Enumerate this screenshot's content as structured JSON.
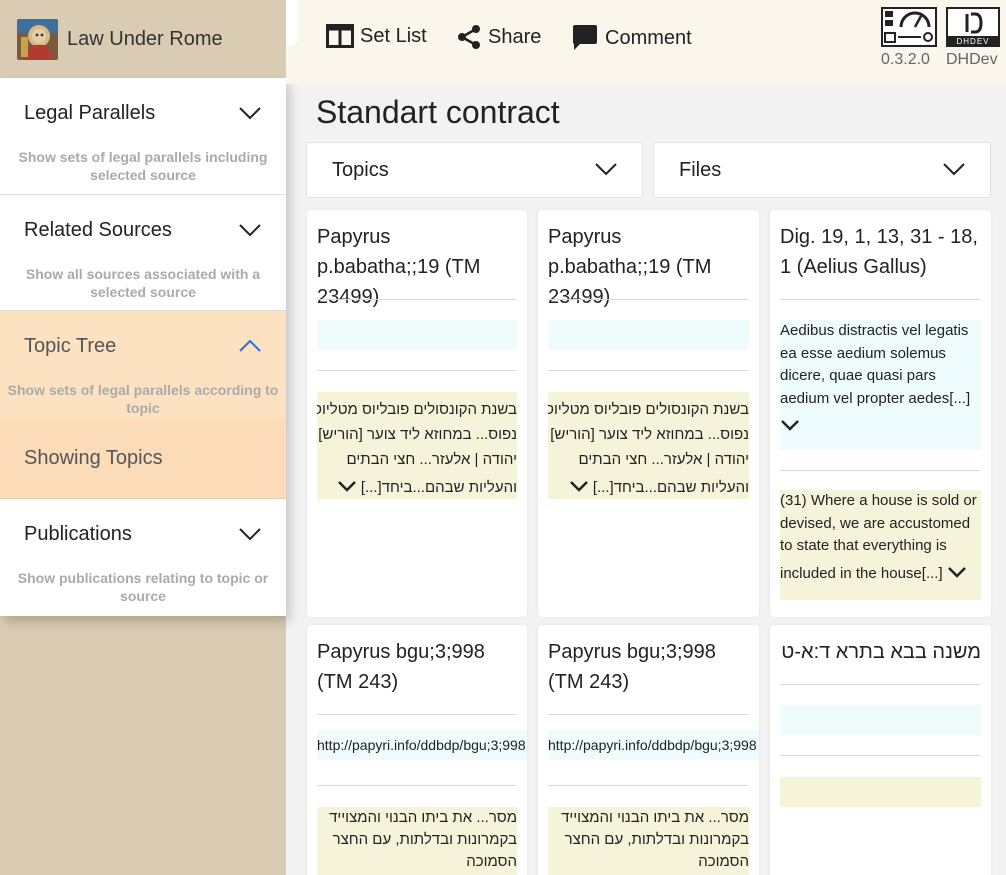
{
  "app": {
    "title": "Law Under Rome"
  },
  "sidebar": {
    "sections": [
      {
        "label": "Legal Parallels",
        "desc": "Show sets of legal parallels including selected source",
        "expanded": false
      },
      {
        "label": "Related Sources",
        "desc": "Show all sources associated with a selected source",
        "expanded": false
      },
      {
        "label": "Topic Tree",
        "desc": "Show sets of legal parallels according to topic",
        "expanded": true
      },
      {
        "label": "Publications",
        "desc": "Show publications relating to topic or source",
        "expanded": false
      }
    ],
    "showing": "Showing Topics"
  },
  "toolbar": {
    "set_list": "Set List",
    "share": "Share",
    "comment": "Comment",
    "version": "0.3.2.0",
    "dhdev": "DHDev",
    "dhdev_logo_text": "DHDEV"
  },
  "main": {
    "title": "Standart contract",
    "dropdowns": {
      "topics": "Topics",
      "files": "Files"
    }
  },
  "cards": [
    {
      "title": "Papyrus p.babatha;;19 (TM 23499)",
      "blue_text": "",
      "tan_lines": [
        "בשנת הקונסולים פובליוס מטליוס",
        "נפוס... במחוזא ליד צוער [הוריש]",
        "יהודה | אלעזר... חצי הבתים",
        "והעליות שבהם...ביחד[...]"
      ]
    },
    {
      "title": "Papyrus p.babatha;;19 (TM 23499)",
      "blue_text": "",
      "tan_lines": [
        "בשנת הקונסולים פובליוס מטליוס",
        "נפוס... במחוזא ליד צוער [הוריש]",
        "יהודה | אלעזר... חצי הבתים",
        "והעליות שבהם...ביחד[...]"
      ]
    },
    {
      "title": "Dig. 19, 1, 13, 31 - 18, 1 (Aelius Gallus)",
      "blue_lines": [
        "Aedibus distractis vel legatis",
        "ea esse aedium solemus",
        "dicere, quae quasi pars",
        "aedium vel propter aedes[...]"
      ],
      "tan_lines": [
        "(31) Where a house is sold or",
        "devised, we are accustomed",
        "to state that everything is",
        "included in the house[...]"
      ]
    },
    {
      "title": "Papyrus bgu;3;998 (TM 243)",
      "blue_text": "http://papyri.info/ddbdp/bgu;3;998",
      "tan_lines": [
        "מסר... את ביתו הבנוי והמצוייד",
        "בקמרונות ובדלתות, עם החצר",
        "הסמוכה"
      ]
    },
    {
      "title": "Papyrus bgu;3;998 (TM 243)",
      "blue_text": "http://papyri.info/ddbdp/bgu;3;998",
      "tan_lines": [
        "מסר... את ביתו הבנוי והמצוייד",
        "בקמרונות ובדלתות, עם החצר",
        "הסמוכה"
      ]
    },
    {
      "title": "משנה בבא בתרא ד:א-ט",
      "blue_text": "",
      "tan_lines": []
    }
  ]
}
